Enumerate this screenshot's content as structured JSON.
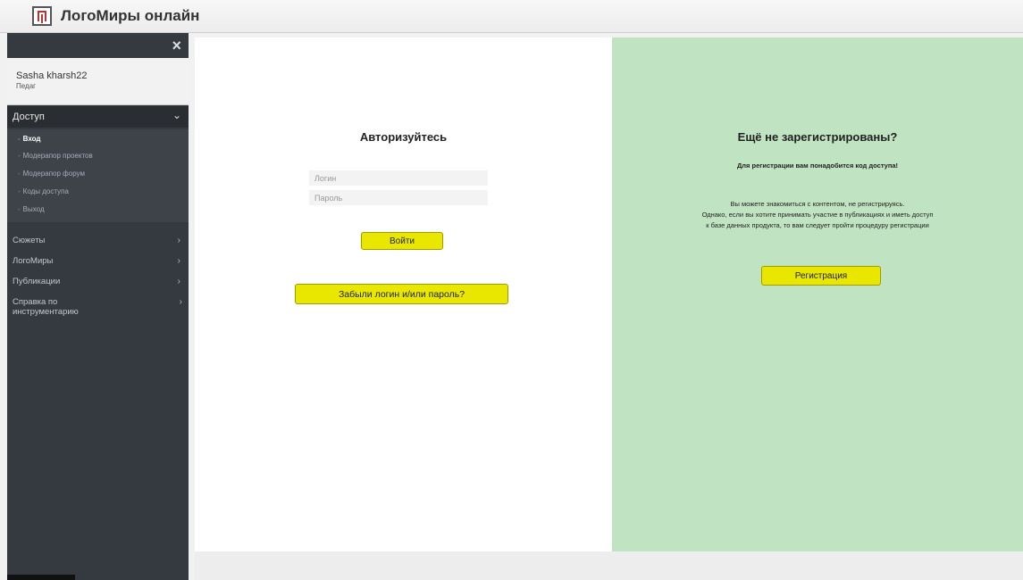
{
  "app": {
    "title": "ЛогоМиры онлайн"
  },
  "sidebar": {
    "close_glyph": "×",
    "user": {
      "name": "Sasha kharsh22",
      "role": "Педаг"
    },
    "section": {
      "label": "Доступ",
      "chevron": "⌄"
    },
    "sub_items": [
      {
        "label": "Вход"
      },
      {
        "label": "Модерапор проектов"
      },
      {
        "label": "Модерапор форум"
      },
      {
        "label": "Коды доступа"
      },
      {
        "label": "Выход"
      }
    ],
    "nav_items": [
      {
        "label": "Сюжеты",
        "arrow": "›"
      },
      {
        "label": "ЛогоМиры",
        "arrow": "›"
      },
      {
        "label": "Публикации",
        "arrow": "›"
      },
      {
        "label": "Справка по инструментарию",
        "arrow": "›"
      }
    ]
  },
  "login": {
    "title": "Авторизуйтесь",
    "login_placeholder": "Логин",
    "password_placeholder": "Пароль",
    "submit_label": "Войти",
    "forgot_label": "Забыли логин и/или пароль?"
  },
  "register": {
    "title": "Ещё не зарегистрированы?",
    "note": "Для регистрации вам понадобится код доступа!",
    "text_lines": [
      "Вы можете знакомиться с контентом, не регистрируясь.",
      "Однако, если вы хотите принимать участие в публикациях и иметь доступ",
      "к базе данных продукта, то вам следует пройти процедуру регистрации"
    ],
    "button_label": "Регистрация"
  },
  "colors": {
    "sidebar_bg": "#343a40",
    "button_yellow": "#e9e600",
    "register_panel": "#c0e4c1"
  }
}
